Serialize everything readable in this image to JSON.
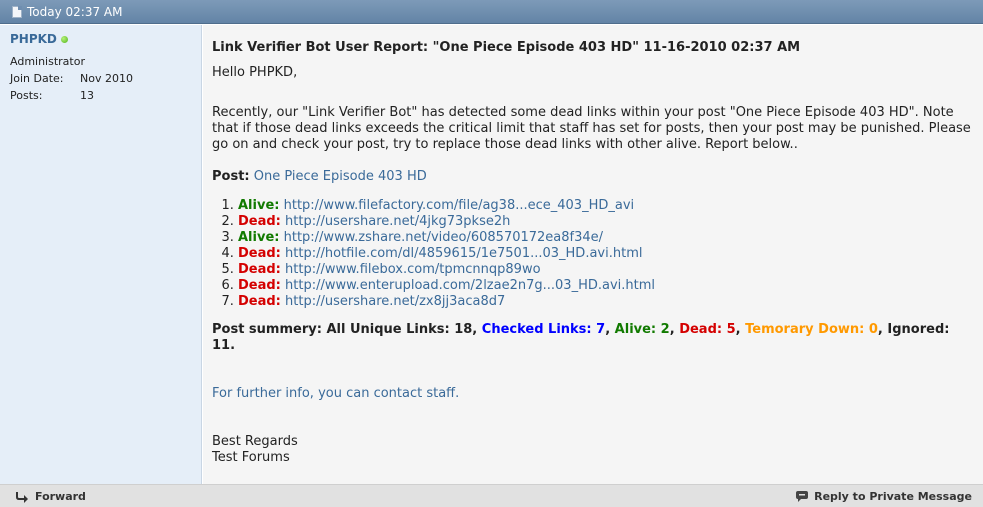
{
  "header": {
    "date": "Today 02:37 AM"
  },
  "sidebar": {
    "username": "PHPKD",
    "usertitle": "Administrator",
    "join_label": "Join Date:",
    "join_value": "Nov 2010",
    "posts_label": "Posts:",
    "posts_value": "13"
  },
  "message": {
    "title": "Link Verifier Bot User Report: \"One Piece Episode 403 HD\" 11-16-2010 02:37 AM",
    "greeting": "Hello PHPKD,",
    "body": "Recently, our \"Link Verifier Bot\" has detected some dead links within your post \"One Piece Episode 403 HD\". Note that if those dead links exceeds the critical limit that staff has set for posts, then your post may be punished. Please go on and check your post, try to replace those dead links with other alive. Report below..",
    "post_label": "Post:",
    "post_link": "One Piece Episode 403 HD",
    "links": [
      {
        "status": "Alive:",
        "url": "http://www.filefactory.com/file/ag38...ece_403_HD_avi"
      },
      {
        "status": "Dead:",
        "url": "http://usershare.net/4jkg73pkse2h"
      },
      {
        "status": "Alive:",
        "url": "http://www.zshare.net/video/608570172ea8f34e/"
      },
      {
        "status": "Dead:",
        "url": "http://hotfile.com/dl/4859615/1e7501...03_HD.avi.html"
      },
      {
        "status": "Dead:",
        "url": "http://www.filebox.com/tpmcnnqp89wo"
      },
      {
        "status": "Dead:",
        "url": "http://www.enterupload.com/2lzae2n7g...03_HD.avi.html"
      },
      {
        "status": "Dead:",
        "url": "http://usershare.net/zx8jj3aca8d7"
      }
    ],
    "summary": {
      "prefix": "Post summery: All Unique Links: 18, ",
      "checked": "Checked Links: 7",
      "alive": "Alive: 2",
      "dead": "Dead: 5",
      "temp": "Temorary Down: 0",
      "ignored": "Ignored: 11."
    },
    "further_info": "For further info, you can contact staff.",
    "regards": "Best Regards",
    "signature": "Test Forums"
  },
  "footer": {
    "forward": "Forward",
    "reply": "Reply to Private Message"
  },
  "colors": {
    "alive": "#117a00",
    "dead": "#d40000",
    "checked": "#0000ff",
    "temp": "#ff9900",
    "link": "#3a6a99"
  }
}
